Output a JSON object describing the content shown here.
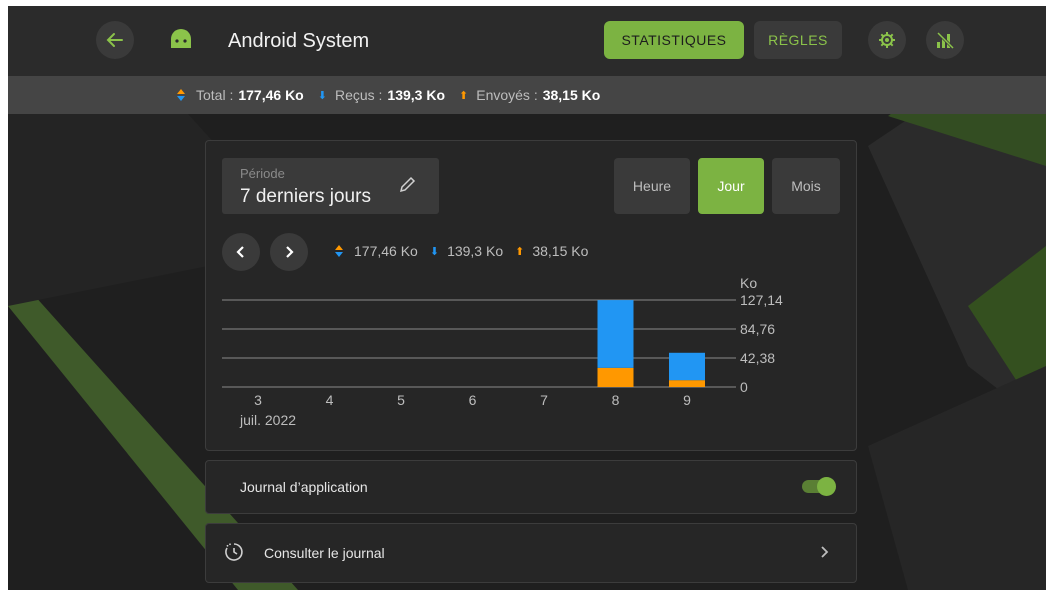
{
  "header": {
    "app_title": "Android System",
    "tab_stats": "STATISTIQUES",
    "tab_rules": "RÈGLES",
    "icons": [
      "back-arrow-icon",
      "android-icon",
      "settings-gear-icon",
      "network-off-icon"
    ]
  },
  "summary": {
    "total_label": "Total :",
    "total_value": "177,46 Ko",
    "received_label": "Reçus :",
    "received_value": "139,3 Ko",
    "sent_label": "Envoyés :",
    "sent_value": "38,15 Ko"
  },
  "period": {
    "label": "Période",
    "value": "7 derniers jours"
  },
  "granularity": {
    "hour": "Heure",
    "day": "Jour",
    "month": "Mois",
    "selected": "Jour"
  },
  "chart_totals": {
    "total": "177,46 Ko",
    "received": "139,3 Ko",
    "sent": "38,15 Ko"
  },
  "chart_data": {
    "type": "bar",
    "stacked": true,
    "categories": [
      "3",
      "4",
      "5",
      "6",
      "7",
      "8",
      "9"
    ],
    "x_sublabel": "juil. 2022",
    "ylabel": "Ko",
    "yticks": [
      "127,14",
      "84,76",
      "42,38",
      "0"
    ],
    "ytick_values": [
      127.14,
      84.76,
      42.38,
      0
    ],
    "ylim": [
      0,
      127.14
    ],
    "series": [
      {
        "name": "Envoyés",
        "color": "#ff9800",
        "values": [
          0,
          0,
          0,
          0,
          0,
          28,
          10
        ]
      },
      {
        "name": "Reçus",
        "color": "#2196f3",
        "values": [
          0,
          0,
          0,
          0,
          0,
          99,
          40
        ]
      }
    ],
    "grid": true
  },
  "app_log": {
    "label": "Journal d’application",
    "enabled": true
  },
  "view_log": {
    "label": "Consulter le journal"
  },
  "colors": {
    "accent": "#7cb342",
    "received": "#2196f3",
    "sent": "#ff9800"
  }
}
